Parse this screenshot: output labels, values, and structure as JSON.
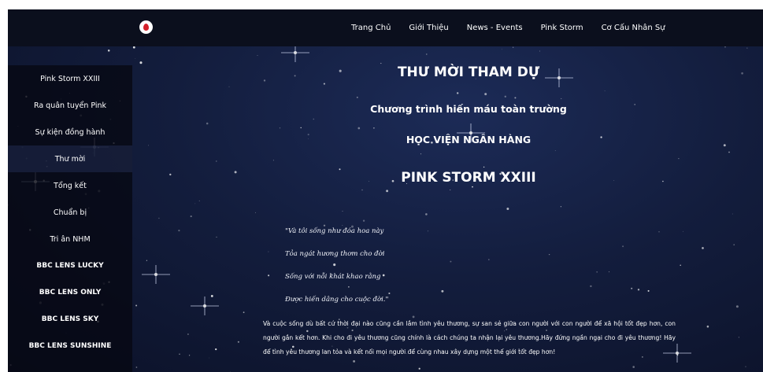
{
  "nav": {
    "links": [
      "Trang Chủ",
      "Giới Thiệu",
      "News - Events",
      "Pink Storm",
      "Cơ Cấu Nhân Sự"
    ]
  },
  "sidebar": {
    "items": [
      {
        "label": "Pink Storm XXIII"
      },
      {
        "label": "Ra quân tuyển Pink"
      },
      {
        "label": "Sự kiện đồng hành"
      },
      {
        "label": "Thư mời"
      },
      {
        "label": "Tổng kết"
      },
      {
        "label": "Chuẩn bị"
      },
      {
        "label": "Tri ân NHM"
      },
      {
        "label": "BBC LENS LUCKY"
      },
      {
        "label": "BBC LENS ONLY"
      },
      {
        "label": "BBC LENS SKY"
      },
      {
        "label": "BBC LENS SUNSHINE"
      }
    ],
    "active_index": 3
  },
  "main": {
    "title": "THƯ MỜI THAM DỰ",
    "subtitle": "Chương trình hiến máu toàn trường",
    "organization": "HỌC VIỆN NGÂN HÀNG",
    "event": "PINK STORM XXIII",
    "poem": [
      "\"Và tôi sống như đóa hoa này",
      "Tỏa ngát hương thơm cho đời",
      "Sống với nỗi khát khao rằng",
      "Được hiến dâng cho cuộc đời.\""
    ],
    "paragraph": "Và cuộc sống dù bất cứ thời đại nào cũng cần lắm tình yêu thương, sự san sẻ giữa con người với con người để xã hội tốt đẹp hơn, con người gắn kết hơn. Khi cho đi yêu thương cũng chính là cách chúng ta nhận lại yêu thương.Hãy đứng ngần ngại cho đi yêu thương! Hãy để tình yêu thương lan tỏa và kết nối mọi người để cùng nhau xây dựng một thế giới tốt đẹp hơn!"
  },
  "colors": {
    "navbar_bg": "#0b0f1d",
    "sky": "#131d3d",
    "logo_drop": "#d4202a"
  },
  "icons": {
    "logo": "blood-drop-logo-icon"
  }
}
